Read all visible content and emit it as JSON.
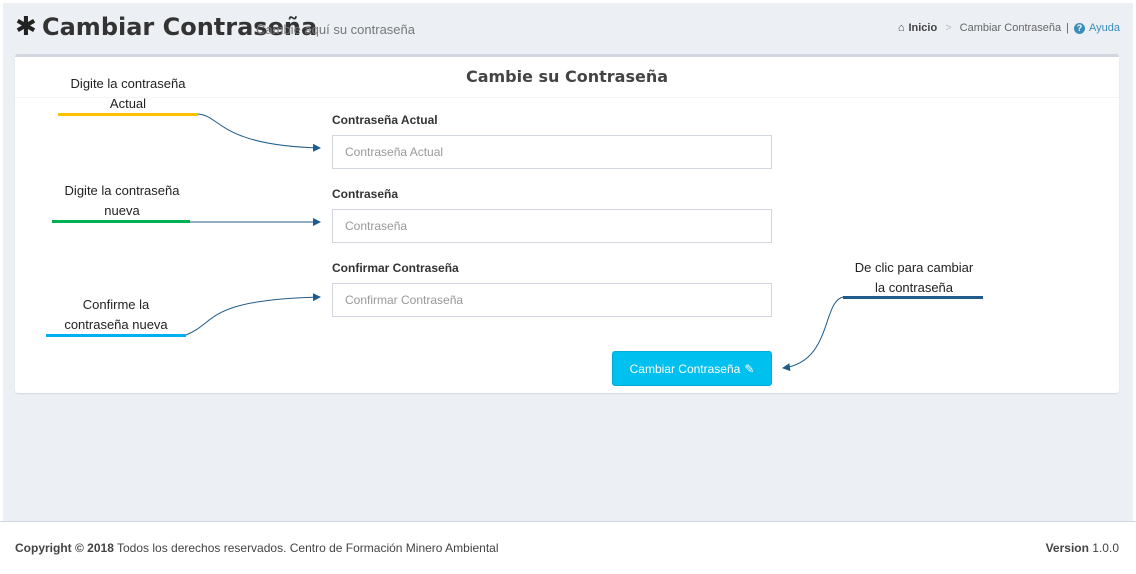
{
  "header": {
    "icon": "asterisk-icon",
    "title": "Cambiar Contraseña",
    "subtitle": "Cambie aquí su contraseña"
  },
  "breadcrumb": {
    "home_icon": "home-icon",
    "home_label": "Inicio",
    "separator": ">",
    "current_label": "Cambiar Contraseña",
    "divider": "|",
    "help_icon": "question-circle-icon",
    "help_label": "Ayuda"
  },
  "form": {
    "title": "Cambie su Contraseña",
    "current_password": {
      "label": "Contraseña Actual",
      "placeholder": "Contraseña Actual",
      "value": ""
    },
    "new_password": {
      "label": "Contraseña",
      "placeholder": "Contraseña",
      "value": ""
    },
    "confirm_password": {
      "label": "Confirmar Contraseña",
      "placeholder": "Confirmar Contraseña",
      "value": ""
    },
    "submit_label": "Cambiar Contraseña",
    "submit_icon": "pencil-icon"
  },
  "annotations": [
    {
      "line1": "Digite la contraseña",
      "line2": "Actual",
      "color": "#ffc000"
    },
    {
      "line1": "Digite la contraseña",
      "line2": "nueva",
      "color": "#00b050"
    },
    {
      "line1": "Confirme la",
      "line2": "contraseña nueva",
      "color": "#00b0f0"
    },
    {
      "line1": "De clic para cambiar",
      "line2": "la contraseña",
      "color": "#1f5c8b"
    }
  ],
  "footer": {
    "copyright_strong": "Copyright © 2018",
    "copyright_text": " Todos los derechos reservados. Centro de Formación Minero Ambiental",
    "version_label": "Version",
    "version_value": "1.0.0"
  },
  "colors": {
    "accent": "#00c0ef",
    "link": "#3c8dbc",
    "arrow": "#1f5c8b"
  }
}
